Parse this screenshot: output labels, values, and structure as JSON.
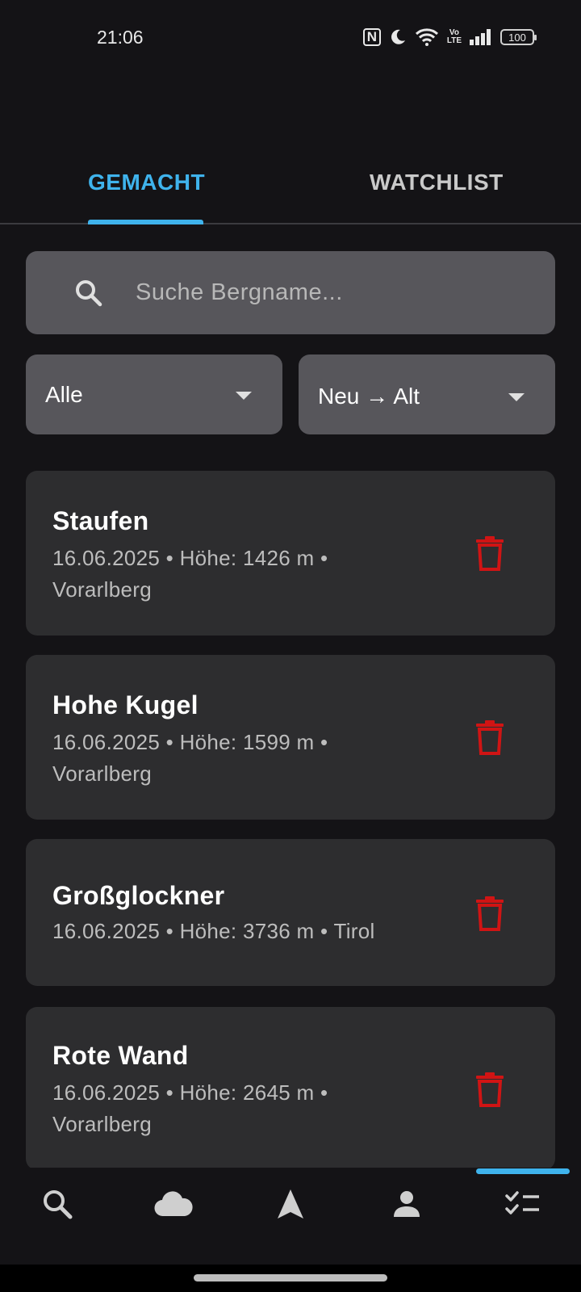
{
  "status_bar": {
    "time": "21:06",
    "battery": "100",
    "volte_top": "Vo",
    "volte_bottom": "LTE",
    "nfc": "N"
  },
  "tabs": [
    {
      "label": "GEMACHT",
      "active": true
    },
    {
      "label": "WATCHLIST",
      "active": false
    }
  ],
  "search": {
    "placeholder": "Suche Bergname...",
    "value": ""
  },
  "filter": {
    "selected": "Alle"
  },
  "sort": {
    "selected": "Neu → Alt"
  },
  "mountains": [
    {
      "name": "Staufen",
      "line1": "16.06.2025 • Höhe: 1426 m •",
      "line2": "Vorarlberg"
    },
    {
      "name": "Hohe Kugel",
      "line1": "16.06.2025 • Höhe: 1599 m •",
      "line2": "Vorarlberg"
    },
    {
      "name": "Großglockner",
      "line1": "16.06.2025 • Höhe: 3736 m • Tirol",
      "line2": ""
    },
    {
      "name": "Rote Wand",
      "line1": "16.06.2025 • Höhe: 2645 m •",
      "line2": "Vorarlberg"
    }
  ],
  "bottom_nav": [
    {
      "icon": "search-icon",
      "active": false
    },
    {
      "icon": "cloud-icon",
      "active": false
    },
    {
      "icon": "navigation-icon",
      "active": false
    },
    {
      "icon": "person-icon",
      "active": false
    },
    {
      "icon": "checklist-icon",
      "active": true
    }
  ],
  "colors": {
    "accent": "#3fb3ec",
    "background": "#141316",
    "card": "#2d2d2f",
    "input": "#57565b",
    "delete": "#d01414"
  }
}
